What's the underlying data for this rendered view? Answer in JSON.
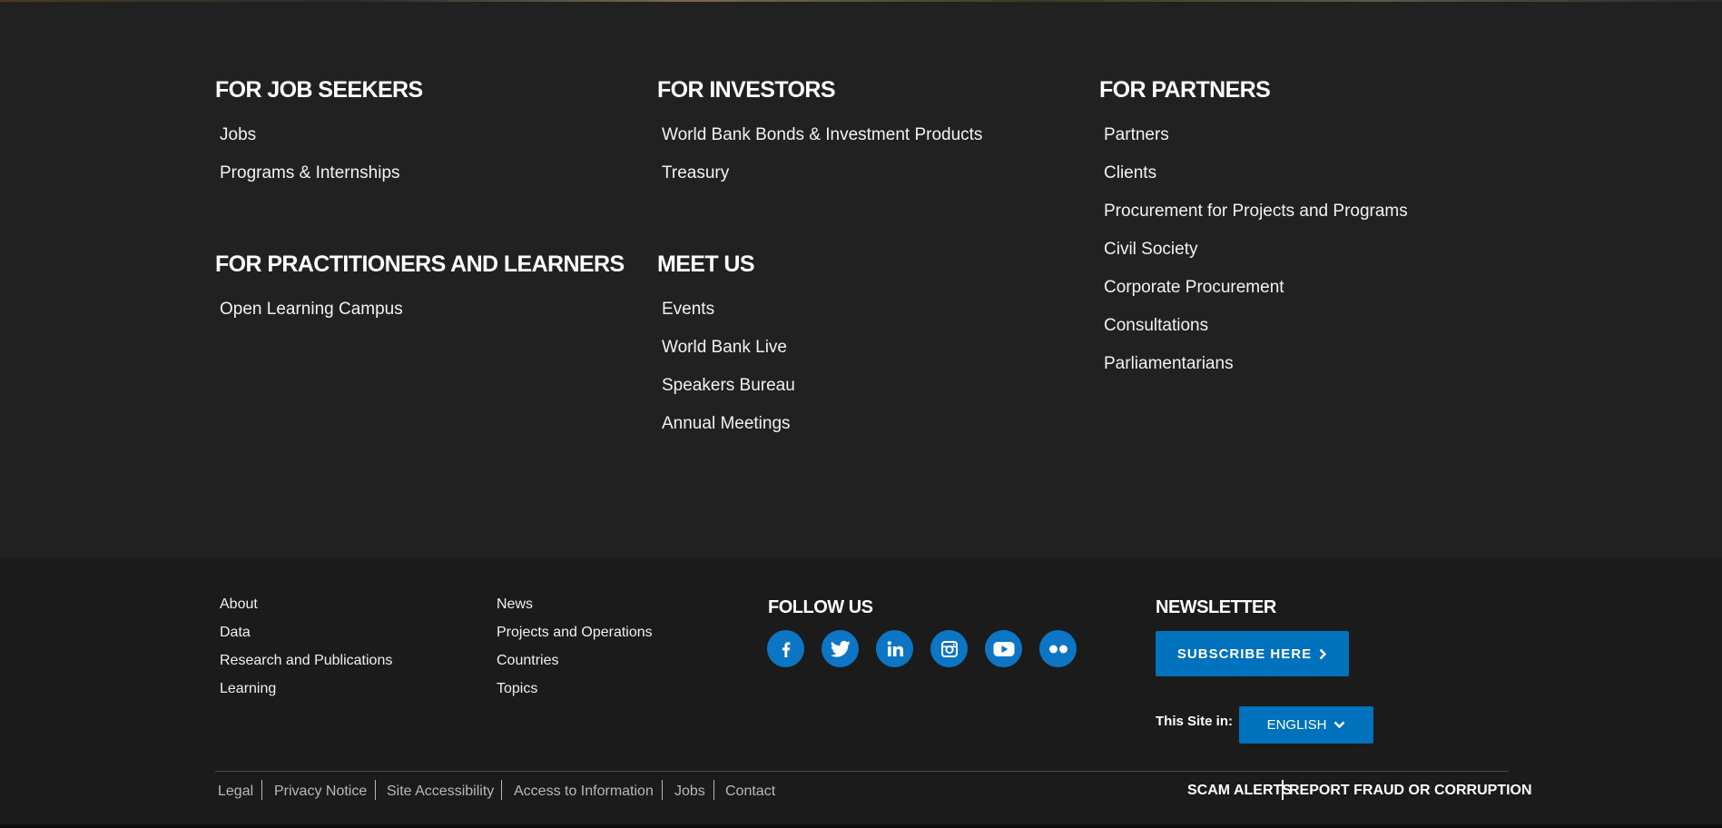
{
  "upper": {
    "job_seekers": {
      "title": "FOR JOB SEEKERS",
      "links": [
        "Jobs",
        "Programs & Internships"
      ]
    },
    "investors": {
      "title": "FOR INVESTORS",
      "links": [
        "World Bank Bonds & Investment Products",
        "Treasury"
      ]
    },
    "partners": {
      "title": "FOR PARTNERS",
      "links": [
        "Partners",
        "Clients",
        "Procurement for Projects and Programs",
        "Civil Society",
        "Corporate Procurement",
        "Consultations",
        "Parliamentarians"
      ]
    },
    "practitioners": {
      "title": "FOR PRACTITIONERS AND LEARNERS",
      "links": [
        "Open Learning Campus"
      ]
    },
    "meet_us": {
      "title": "MEET US",
      "links": [
        "Events",
        "World Bank Live",
        "Speakers Bureau",
        "Annual Meetings"
      ]
    }
  },
  "footer": {
    "col1": [
      "About",
      "Data",
      "Research and Publications",
      "Learning"
    ],
    "col2": [
      "News",
      "Projects and Operations",
      "Countries",
      "Topics"
    ],
    "follow_title": "FOLLOW US",
    "social": [
      "facebook-icon",
      "twitter-icon",
      "linkedin-icon",
      "instagram-icon",
      "youtube-icon",
      "flickr-icon"
    ],
    "newsletter_title": "NEWSLETTER",
    "subscribe_label": "SUBSCRIBE HERE",
    "site_in_label": "This Site in:",
    "language": "ENGLISH",
    "legal_links": [
      "Legal",
      "Privacy Notice",
      "Site Accessibility",
      "Access to Information",
      "Jobs",
      "Contact"
    ],
    "scam_alerts": "SCAM ALERTS",
    "report_fraud": "REPORT FRAUD OR CORRUPTION"
  },
  "colors": {
    "accent": "#0071bc",
    "background": "#212121",
    "footer_background": "#1b1b1b"
  }
}
